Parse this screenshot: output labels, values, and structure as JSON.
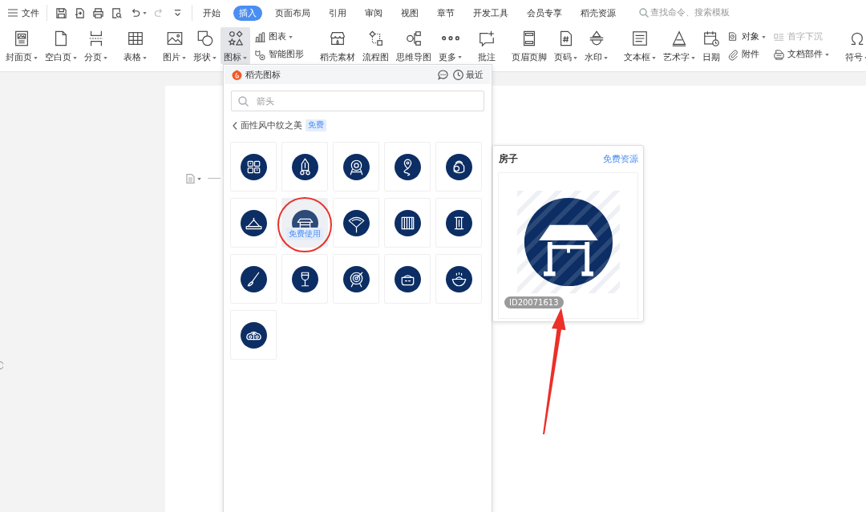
{
  "top_bar": {
    "menu_label": "文件",
    "quick_access": [
      {
        "kind": "save",
        "dropdown": false,
        "disabled": false
      },
      {
        "kind": "export",
        "dropdown": false,
        "disabled": false
      },
      {
        "kind": "print",
        "dropdown": false,
        "disabled": false
      },
      {
        "kind": "preview",
        "dropdown": false,
        "disabled": false
      },
      {
        "kind": "undo",
        "dropdown": true,
        "disabled": false
      },
      {
        "kind": "redo",
        "dropdown": false,
        "disabled": true
      },
      {
        "kind": "customize",
        "dropdown": false,
        "disabled": false
      }
    ],
    "tabs": [
      {
        "label": "开始",
        "selected": false
      },
      {
        "label": "插入",
        "selected": true
      },
      {
        "label": "页面布局",
        "selected": false
      },
      {
        "label": "引用",
        "selected": false
      },
      {
        "label": "审阅",
        "selected": false
      },
      {
        "label": "视图",
        "selected": false
      },
      {
        "label": "章节",
        "selected": false
      },
      {
        "label": "开发工具",
        "selected": false
      },
      {
        "label": "会员专享",
        "selected": false
      },
      {
        "label": "稻壳资源",
        "selected": false
      }
    ],
    "search": {
      "placeholder": "查找命令、搜索模板"
    }
  },
  "ribbon": {
    "groups": [
      {
        "items": [
          {
            "kind": "cover",
            "label": "封面页",
            "dropdown": true,
            "pressed": false,
            "disabled": false
          },
          {
            "kind": "blank",
            "label": "空白页",
            "dropdown": true,
            "pressed": false,
            "disabled": false
          },
          {
            "kind": "pagebreak",
            "label": "分页",
            "dropdown": true,
            "pressed": false,
            "disabled": false
          }
        ]
      },
      {
        "items": [
          {
            "kind": "table",
            "label": "表格",
            "dropdown": true,
            "pressed": false,
            "disabled": false
          }
        ]
      },
      {
        "items": [
          {
            "kind": "picture",
            "label": "图片",
            "dropdown": true,
            "pressed": false,
            "disabled": false
          },
          {
            "kind": "shape",
            "label": "形状",
            "dropdown": true,
            "pressed": false,
            "disabled": false
          },
          {
            "kind": "iconset",
            "label": "图标",
            "dropdown": true,
            "pressed": true,
            "disabled": false
          },
          {
            "stack": [
              {
                "kind": "chart",
                "label": "图表",
                "dropdown": true,
                "pressed": false,
                "disabled": false
              },
              {
                "kind": "smartart",
                "label": "智能图形",
                "dropdown": false,
                "pressed": false,
                "disabled": false
              }
            ]
          }
        ]
      },
      {
        "items": [
          {
            "kind": "material",
            "label": "稻壳素材",
            "dropdown": false,
            "pressed": false,
            "disabled": false
          },
          {
            "kind": "flowchart",
            "label": "流程图",
            "dropdown": false,
            "pressed": false,
            "disabled": false
          },
          {
            "kind": "mindmap",
            "label": "思维导图",
            "dropdown": false,
            "pressed": false,
            "disabled": false
          },
          {
            "kind": "more",
            "label": "更多",
            "dropdown": true,
            "pressed": false,
            "disabled": false
          }
        ]
      },
      {
        "items": [
          {
            "kind": "comment",
            "label": "批注",
            "dropdown": false,
            "pressed": false,
            "disabled": false
          }
        ]
      },
      {
        "items": [
          {
            "kind": "headerfooter",
            "label": "页眉页脚",
            "dropdown": false,
            "pressed": false,
            "disabled": false
          },
          {
            "kind": "pagenumber",
            "label": "页码",
            "dropdown": true,
            "pressed": false,
            "disabled": false
          },
          {
            "kind": "watermark",
            "label": "水印",
            "dropdown": true,
            "pressed": false,
            "disabled": false
          }
        ]
      },
      {
        "items": [
          {
            "kind": "textbox",
            "label": "文本框",
            "dropdown": true,
            "pressed": false,
            "disabled": false
          },
          {
            "kind": "wordart",
            "label": "艺术字",
            "dropdown": true,
            "pressed": false,
            "disabled": false
          },
          {
            "kind": "date",
            "label": "日期",
            "dropdown": false,
            "pressed": false,
            "disabled": false
          },
          {
            "stack": [
              {
                "kind": "object",
                "label": "对象",
                "dropdown": true,
                "pressed": false,
                "disabled": false
              },
              {
                "kind": "attachment",
                "label": "附件",
                "dropdown": false,
                "pressed": false,
                "disabled": false
              }
            ]
          },
          {
            "stack": [
              {
                "kind": "dropcap",
                "label": "首字下沉",
                "dropdown": false,
                "pressed": false,
                "disabled": true
              },
              {
                "kind": "docparts",
                "label": "文档部件",
                "dropdown": true,
                "pressed": false,
                "disabled": false
              }
            ]
          }
        ]
      },
      {
        "items": [
          {
            "kind": "symbol",
            "label": "符号",
            "dropdown": true,
            "pressed": false,
            "disabled": false
          }
        ]
      }
    ]
  },
  "icon_panel": {
    "title": "稻壳图标",
    "recent_label": "最近",
    "search": {
      "placeholder": "箭头"
    },
    "breadcrumb": {
      "label": "面性风中纹之美",
      "badge": "免费"
    },
    "tiles": [
      {
        "kind": "grid",
        "hovered": false
      },
      {
        "kind": "rocket",
        "hovered": false
      },
      {
        "kind": "drum",
        "hovered": false
      },
      {
        "kind": "pin",
        "hovered": false
      },
      {
        "kind": "bag",
        "hovered": false
      },
      {
        "kind": "hat",
        "hovered": false
      },
      {
        "kind": "gate",
        "hovered": true,
        "action": "免费使用"
      },
      {
        "kind": "fan",
        "hovered": false
      },
      {
        "kind": "window",
        "hovered": false
      },
      {
        "kind": "scroll",
        "hovered": false
      },
      {
        "kind": "brush",
        "hovered": false
      },
      {
        "kind": "goblet",
        "hovered": false
      },
      {
        "kind": "target",
        "hovered": false
      },
      {
        "kind": "pot",
        "hovered": false
      },
      {
        "kind": "bowl",
        "hovered": false
      },
      {
        "kind": "cloud",
        "hovered": false
      }
    ]
  },
  "preview_card": {
    "title": "房子",
    "link": "免费资源",
    "kind": "gate",
    "id_badge": "ID20071613"
  },
  "annotations": [
    {
      "kind": "ring"
    },
    {
      "kind": "arrow"
    }
  ]
}
